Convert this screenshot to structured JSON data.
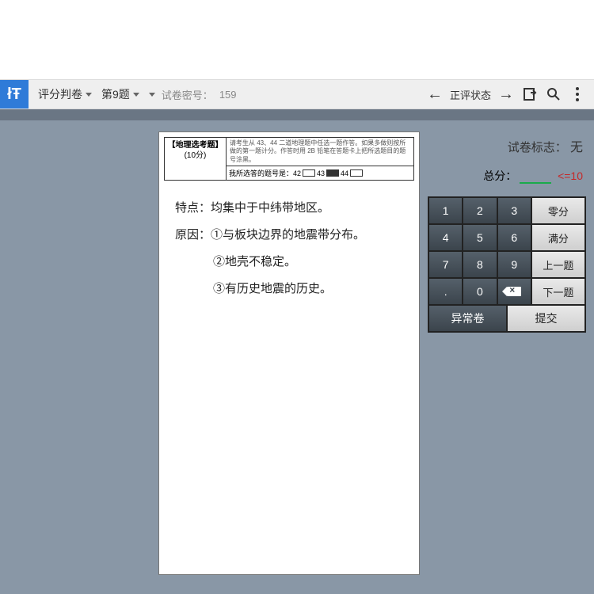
{
  "toolbar": {
    "app_label": "评分判卷",
    "question_label": "第9题",
    "paper_secret_prefix": "试卷密号：",
    "paper_secret_value": "159",
    "status_label": "正评状态"
  },
  "paper": {
    "section_title": "【地理选考题】",
    "section_points": "(10分)",
    "instruction_tiny": "请考生从 43、44 二道地理题中任选一题作答。如果多做则按所做的第一题计分。作答时用 2B 铅笔在答题卡上把所选题目的题号涂黑。",
    "choose_label": "我所选答的题号是：",
    "qnums": [
      "42",
      "43",
      "44"
    ],
    "filled_index": 1,
    "hw": {
      "l1": "特点：均集中于中纬带地区。",
      "l2": "原因：①与板块边界的地震带分布。",
      "l3": "②地壳不稳定。",
      "l4": "③有历史地震的历史。"
    }
  },
  "panel": {
    "mark_label": "试卷标志：",
    "mark_value": "无",
    "total_label": "总分：",
    "score_value": "",
    "max_hint": "<=10"
  },
  "keypad": {
    "r1": [
      "1",
      "2",
      "3"
    ],
    "r1_side": "零分",
    "r2": [
      "4",
      "5",
      "6"
    ],
    "r2_side": "满分",
    "r3": [
      "7",
      "8",
      "9"
    ],
    "r3_side": "上一题",
    "r4": [
      ".",
      "0"
    ],
    "r4_side": "下一题",
    "bottom_left": "异常卷",
    "bottom_right": "提交"
  }
}
